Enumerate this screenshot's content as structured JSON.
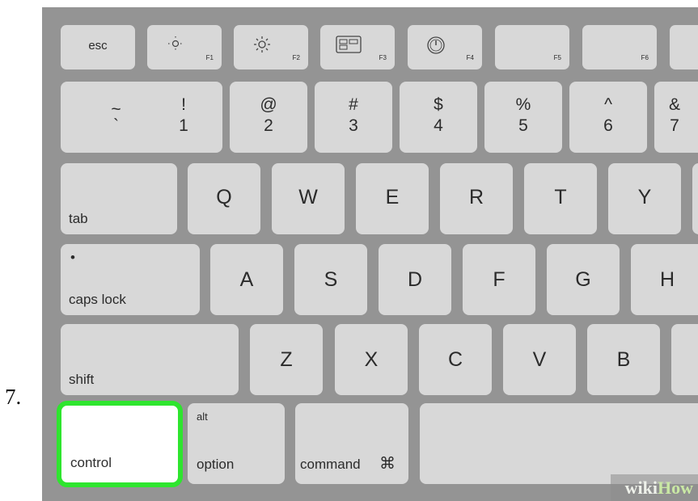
{
  "step_number": "7.",
  "function_row": {
    "esc": "esc",
    "f1": "F1",
    "f2": "F2",
    "f3": "F3",
    "f4": "F4",
    "f5": "F5",
    "f6": "F6"
  },
  "number_row": [
    {
      "top": "~",
      "bottom": "`"
    },
    {
      "top": "!",
      "bottom": "1"
    },
    {
      "top": "@",
      "bottom": "2"
    },
    {
      "top": "#",
      "bottom": "3"
    },
    {
      "top": "$",
      "bottom": "4"
    },
    {
      "top": "%",
      "bottom": "5"
    },
    {
      "top": "^",
      "bottom": "6"
    },
    {
      "top": "&",
      "bottom": "7"
    }
  ],
  "qwerty_row": {
    "tab": "tab",
    "letters": [
      "Q",
      "W",
      "E",
      "R",
      "T",
      "Y"
    ]
  },
  "home_row": {
    "caps_dot": "•",
    "caps": "caps lock",
    "letters": [
      "A",
      "S",
      "D",
      "F",
      "G",
      "H"
    ]
  },
  "bottom_letter_row": {
    "shift": "shift",
    "letters": [
      "Z",
      "X",
      "C",
      "V",
      "B"
    ]
  },
  "modifier_row": {
    "control": "control",
    "option_alt": "alt",
    "option": "option",
    "command": "command",
    "command_symbol": "⌘"
  },
  "watermark": {
    "part1": "wiki",
    "part2": "How"
  },
  "colors": {
    "highlight": "#2ee52e",
    "key": "#d8d8d8",
    "keyboard": "#949494"
  }
}
